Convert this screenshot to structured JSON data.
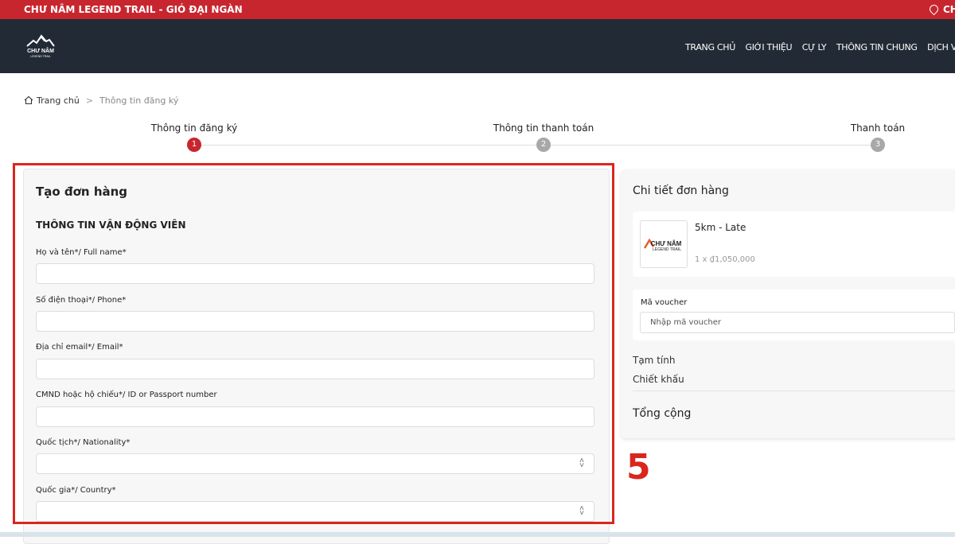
{
  "topbar": {
    "title": "CHƯ NÂM LEGEND TRAIL - GIÓ ĐẠI NGÀN",
    "location_text": "CH"
  },
  "logo": {
    "text_main": "CHƯ NÂM",
    "text_sub": "LEGEND TRAIL"
  },
  "nav": {
    "items": [
      "TRANG CHỦ",
      "GIỚI THIỆU",
      "CỰ LY",
      "THÔNG TIN CHUNG",
      "DỊCH VỤ"
    ]
  },
  "breadcrumb": {
    "home": "Trang chủ",
    "current": "Thông tin đăng ký"
  },
  "steps": [
    {
      "label": "Thông tin đăng ký",
      "number": "1",
      "state": "active"
    },
    {
      "label": "Thông tin thanh toán",
      "number": "2",
      "state": "inactive"
    },
    {
      "label": "Thanh toán",
      "number": "3",
      "state": "inactive"
    }
  ],
  "colors": {
    "brand_red": "#c8262f",
    "nav_bg": "#222b35",
    "step_active": "#c8262f",
    "step_inactive": "#a8a8a8",
    "annotation_red": "#d9261f"
  },
  "form": {
    "title": "Tạo đơn hàng",
    "section": "THÔNG TIN VẬN ĐỘNG VIÊN",
    "fields": [
      {
        "label": "Họ và tên*/ Full name*",
        "value": "",
        "type": "text"
      },
      {
        "label": "Số điện thoại*/ Phone*",
        "value": "",
        "type": "text"
      },
      {
        "label": "Địa chỉ email*/ Email*",
        "value": "",
        "type": "text"
      },
      {
        "label": "CMND hoặc hộ chiếu*/ ID or Passport number",
        "value": "",
        "type": "text"
      },
      {
        "label": "Quốc tịch*/ Nationality*",
        "value": "",
        "type": "select"
      },
      {
        "label": "Quốc gia*/ Country*",
        "value": "",
        "type": "select"
      }
    ]
  },
  "annotation": {
    "number": "5"
  },
  "order": {
    "title": "Chi tiết đơn hàng",
    "product": {
      "name": "5km - Late",
      "qty_price": "1 x ₫1,050,000",
      "thumb_text": "CHƯ NÂM",
      "thumb_sub": "LEGEND TRAIL"
    },
    "voucher": {
      "label": "Mã voucher",
      "placeholder": "Nhập mã voucher"
    },
    "subtotal_label": "Tạm tính",
    "discount_label": "Chiết khấu",
    "total_label": "Tổng cộng"
  }
}
